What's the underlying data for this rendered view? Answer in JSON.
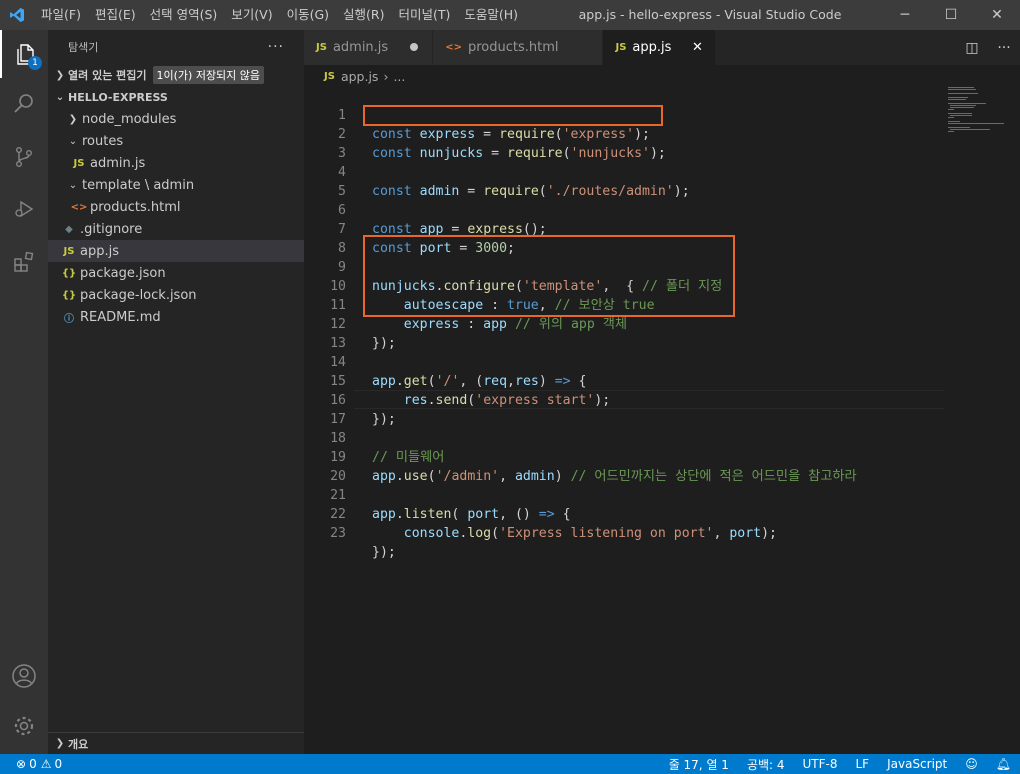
{
  "titlebar": {
    "menu": [
      "파일(F)",
      "편집(E)",
      "선택 영역(S)",
      "보기(V)",
      "이동(G)",
      "실행(R)",
      "터미널(T)",
      "도움말(H)"
    ],
    "window_title": "app.js - hello-express - Visual Studio Code"
  },
  "activity": {
    "explorer_badge": "1"
  },
  "sidebar": {
    "title": "탐색기",
    "open_editors_label": "열려 있는 편집기",
    "unsaved_badge": "1이(가) 저장되지 않음",
    "project_label": "HELLO-EXPRESS",
    "tree": [
      {
        "label": "node_modules",
        "type": "folder",
        "expanded": false
      },
      {
        "label": "routes",
        "type": "folder",
        "expanded": true
      },
      {
        "label": "admin.js",
        "type": "js",
        "icon": "JS"
      },
      {
        "label": "template \\ admin",
        "type": "folder",
        "expanded": true
      },
      {
        "label": "products.html",
        "type": "html",
        "icon": "<>"
      },
      {
        "label": ".gitignore",
        "type": "git",
        "icon": "◆"
      },
      {
        "label": "app.js",
        "type": "js",
        "icon": "JS",
        "selected": true
      },
      {
        "label": "package.json",
        "type": "json",
        "icon": "{}"
      },
      {
        "label": "package-lock.json",
        "type": "json",
        "icon": "{}"
      },
      {
        "label": "README.md",
        "type": "info",
        "icon": "ⓘ"
      }
    ],
    "outline_label": "개요"
  },
  "tabs": [
    {
      "label": "admin.js",
      "icon": "JS",
      "modified": true
    },
    {
      "label": "products.html",
      "icon": "<>",
      "modified": false
    },
    {
      "label": "app.js",
      "icon": "JS",
      "active": true
    }
  ],
  "breadcrumb": {
    "file": "app.js",
    "icon": "JS",
    "rest": "..."
  },
  "editor": {
    "lines": [
      "1",
      "2",
      "3",
      "4",
      "5",
      "6",
      "7",
      "8",
      "9",
      "10",
      "11",
      "12",
      "13",
      "14",
      "15",
      "16",
      "17",
      "18",
      "19",
      "20",
      "21",
      "22",
      "23"
    ]
  },
  "code": {
    "l1_a": "const",
    "l1_b": "express",
    "l1_c": " = ",
    "l1_d": "require",
    "l1_e": "(",
    "l1_f": "'express'",
    "l1_g": ");",
    "l2_a": "const",
    "l2_b": "nunjucks",
    "l2_c": " = ",
    "l2_d": "require",
    "l2_e": "(",
    "l2_f": "'nunjucks'",
    "l2_g": ");",
    "l4_a": "const",
    "l4_b": "admin",
    "l4_c": " = ",
    "l4_d": "require",
    "l4_e": "(",
    "l4_f": "'./routes/admin'",
    "l4_g": ");",
    "l6_a": "const",
    "l6_b": "app",
    "l6_c": " = ",
    "l6_d": "express",
    "l6_e": "();",
    "l7_a": "const",
    "l7_b": "port",
    "l7_c": " = ",
    "l7_d": "3000",
    "l7_e": ";",
    "l9_a": "nunjucks",
    "l9_b": ".",
    "l9_c": "configure",
    "l9_d": "(",
    "l9_e": "'template'",
    "l9_f": ",  { ",
    "l9_g": "// 폴더 지정",
    "l10_a": "    autoescape",
    "l10_b": " : ",
    "l10_c": "true",
    "l10_d": ", ",
    "l10_e": "// 보안상 true",
    "l11_a": "    express",
    "l11_b": " : ",
    "l11_c": "app",
    "l11_d": " ",
    "l11_e": "// 위의 app 객체",
    "l12_a": "});",
    "l14_a": "app",
    "l14_b": ".",
    "l14_c": "get",
    "l14_d": "(",
    "l14_e": "'/'",
    "l14_f": ", (",
    "l14_g": "req",
    "l14_h": ",",
    "l14_i": "res",
    "l14_j": ") ",
    "l14_k": "=>",
    "l14_l": " {",
    "l15_a": "    res",
    "l15_b": ".",
    "l15_c": "send",
    "l15_d": "(",
    "l15_e": "'express start'",
    "l15_f": ");",
    "l16_a": "});",
    "l18_a": "// 미들웨어",
    "l19_a": "app",
    "l19_b": ".",
    "l19_c": "use",
    "l19_d": "(",
    "l19_e": "'/admin'",
    "l19_f": ", ",
    "l19_g": "admin",
    "l19_h": ") ",
    "l19_i": "// 어드민까지는 상단에 적은 어드민을 참고하라",
    "l21_a": "app",
    "l21_b": ".",
    "l21_c": "listen",
    "l21_d": "( ",
    "l21_e": "port",
    "l21_f": ", () ",
    "l21_g": "=>",
    "l21_h": " {",
    "l22_a": "    console",
    "l22_b": ".",
    "l22_c": "log",
    "l22_d": "(",
    "l22_e": "'Express listening on port'",
    "l22_f": ", ",
    "l22_g": "port",
    "l22_h": ");",
    "l23_a": "});"
  },
  "statusbar": {
    "errors": "0",
    "warnings": "0",
    "position": "줄 17, 열 1",
    "spaces": "공백: 4",
    "encoding": "UTF-8",
    "eol": "LF",
    "language": "JavaScript"
  },
  "colors": {
    "accent": "#007acc",
    "highlight_box": "#e8682a"
  }
}
